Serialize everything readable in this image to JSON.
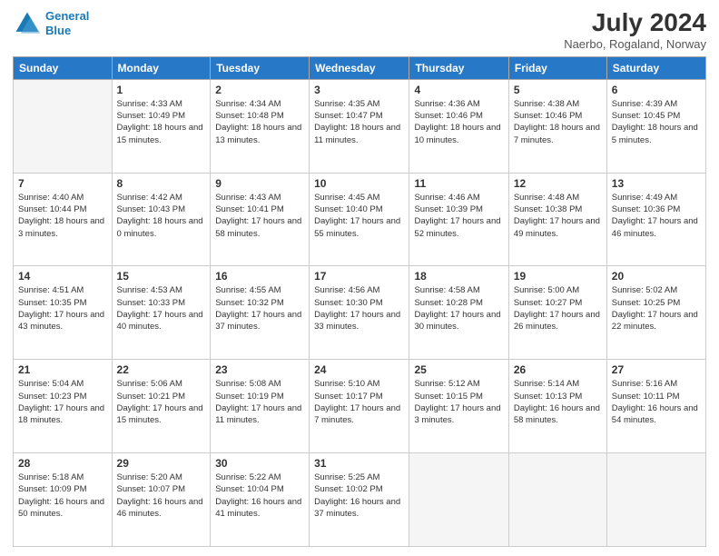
{
  "header": {
    "logo_line1": "General",
    "logo_line2": "Blue",
    "month_year": "July 2024",
    "location": "Naerbo, Rogaland, Norway"
  },
  "weekdays": [
    "Sunday",
    "Monday",
    "Tuesday",
    "Wednesday",
    "Thursday",
    "Friday",
    "Saturday"
  ],
  "weeks": [
    [
      {
        "day": "",
        "sunrise": "",
        "sunset": "",
        "daylight": ""
      },
      {
        "day": "1",
        "sunrise": "Sunrise: 4:33 AM",
        "sunset": "Sunset: 10:49 PM",
        "daylight": "Daylight: 18 hours and 15 minutes."
      },
      {
        "day": "2",
        "sunrise": "Sunrise: 4:34 AM",
        "sunset": "Sunset: 10:48 PM",
        "daylight": "Daylight: 18 hours and 13 minutes."
      },
      {
        "day": "3",
        "sunrise": "Sunrise: 4:35 AM",
        "sunset": "Sunset: 10:47 PM",
        "daylight": "Daylight: 18 hours and 11 minutes."
      },
      {
        "day": "4",
        "sunrise": "Sunrise: 4:36 AM",
        "sunset": "Sunset: 10:46 PM",
        "daylight": "Daylight: 18 hours and 10 minutes."
      },
      {
        "day": "5",
        "sunrise": "Sunrise: 4:38 AM",
        "sunset": "Sunset: 10:46 PM",
        "daylight": "Daylight: 18 hours and 7 minutes."
      },
      {
        "day": "6",
        "sunrise": "Sunrise: 4:39 AM",
        "sunset": "Sunset: 10:45 PM",
        "daylight": "Daylight: 18 hours and 5 minutes."
      }
    ],
    [
      {
        "day": "7",
        "sunrise": "Sunrise: 4:40 AM",
        "sunset": "Sunset: 10:44 PM",
        "daylight": "Daylight: 18 hours and 3 minutes."
      },
      {
        "day": "8",
        "sunrise": "Sunrise: 4:42 AM",
        "sunset": "Sunset: 10:43 PM",
        "daylight": "Daylight: 18 hours and 0 minutes."
      },
      {
        "day": "9",
        "sunrise": "Sunrise: 4:43 AM",
        "sunset": "Sunset: 10:41 PM",
        "daylight": "Daylight: 17 hours and 58 minutes."
      },
      {
        "day": "10",
        "sunrise": "Sunrise: 4:45 AM",
        "sunset": "Sunset: 10:40 PM",
        "daylight": "Daylight: 17 hours and 55 minutes."
      },
      {
        "day": "11",
        "sunrise": "Sunrise: 4:46 AM",
        "sunset": "Sunset: 10:39 PM",
        "daylight": "Daylight: 17 hours and 52 minutes."
      },
      {
        "day": "12",
        "sunrise": "Sunrise: 4:48 AM",
        "sunset": "Sunset: 10:38 PM",
        "daylight": "Daylight: 17 hours and 49 minutes."
      },
      {
        "day": "13",
        "sunrise": "Sunrise: 4:49 AM",
        "sunset": "Sunset: 10:36 PM",
        "daylight": "Daylight: 17 hours and 46 minutes."
      }
    ],
    [
      {
        "day": "14",
        "sunrise": "Sunrise: 4:51 AM",
        "sunset": "Sunset: 10:35 PM",
        "daylight": "Daylight: 17 hours and 43 minutes."
      },
      {
        "day": "15",
        "sunrise": "Sunrise: 4:53 AM",
        "sunset": "Sunset: 10:33 PM",
        "daylight": "Daylight: 17 hours and 40 minutes."
      },
      {
        "day": "16",
        "sunrise": "Sunrise: 4:55 AM",
        "sunset": "Sunset: 10:32 PM",
        "daylight": "Daylight: 17 hours and 37 minutes."
      },
      {
        "day": "17",
        "sunrise": "Sunrise: 4:56 AM",
        "sunset": "Sunset: 10:30 PM",
        "daylight": "Daylight: 17 hours and 33 minutes."
      },
      {
        "day": "18",
        "sunrise": "Sunrise: 4:58 AM",
        "sunset": "Sunset: 10:28 PM",
        "daylight": "Daylight: 17 hours and 30 minutes."
      },
      {
        "day": "19",
        "sunrise": "Sunrise: 5:00 AM",
        "sunset": "Sunset: 10:27 PM",
        "daylight": "Daylight: 17 hours and 26 minutes."
      },
      {
        "day": "20",
        "sunrise": "Sunrise: 5:02 AM",
        "sunset": "Sunset: 10:25 PM",
        "daylight": "Daylight: 17 hours and 22 minutes."
      }
    ],
    [
      {
        "day": "21",
        "sunrise": "Sunrise: 5:04 AM",
        "sunset": "Sunset: 10:23 PM",
        "daylight": "Daylight: 17 hours and 18 minutes."
      },
      {
        "day": "22",
        "sunrise": "Sunrise: 5:06 AM",
        "sunset": "Sunset: 10:21 PM",
        "daylight": "Daylight: 17 hours and 15 minutes."
      },
      {
        "day": "23",
        "sunrise": "Sunrise: 5:08 AM",
        "sunset": "Sunset: 10:19 PM",
        "daylight": "Daylight: 17 hours and 11 minutes."
      },
      {
        "day": "24",
        "sunrise": "Sunrise: 5:10 AM",
        "sunset": "Sunset: 10:17 PM",
        "daylight": "Daylight: 17 hours and 7 minutes."
      },
      {
        "day": "25",
        "sunrise": "Sunrise: 5:12 AM",
        "sunset": "Sunset: 10:15 PM",
        "daylight": "Daylight: 17 hours and 3 minutes."
      },
      {
        "day": "26",
        "sunrise": "Sunrise: 5:14 AM",
        "sunset": "Sunset: 10:13 PM",
        "daylight": "Daylight: 16 hours and 58 minutes."
      },
      {
        "day": "27",
        "sunrise": "Sunrise: 5:16 AM",
        "sunset": "Sunset: 10:11 PM",
        "daylight": "Daylight: 16 hours and 54 minutes."
      }
    ],
    [
      {
        "day": "28",
        "sunrise": "Sunrise: 5:18 AM",
        "sunset": "Sunset: 10:09 PM",
        "daylight": "Daylight: 16 hours and 50 minutes."
      },
      {
        "day": "29",
        "sunrise": "Sunrise: 5:20 AM",
        "sunset": "Sunset: 10:07 PM",
        "daylight": "Daylight: 16 hours and 46 minutes."
      },
      {
        "day": "30",
        "sunrise": "Sunrise: 5:22 AM",
        "sunset": "Sunset: 10:04 PM",
        "daylight": "Daylight: 16 hours and 41 minutes."
      },
      {
        "day": "31",
        "sunrise": "Sunrise: 5:25 AM",
        "sunset": "Sunset: 10:02 PM",
        "daylight": "Daylight: 16 hours and 37 minutes."
      },
      {
        "day": "",
        "sunrise": "",
        "sunset": "",
        "daylight": ""
      },
      {
        "day": "",
        "sunrise": "",
        "sunset": "",
        "daylight": ""
      },
      {
        "day": "",
        "sunrise": "",
        "sunset": "",
        "daylight": ""
      }
    ]
  ]
}
